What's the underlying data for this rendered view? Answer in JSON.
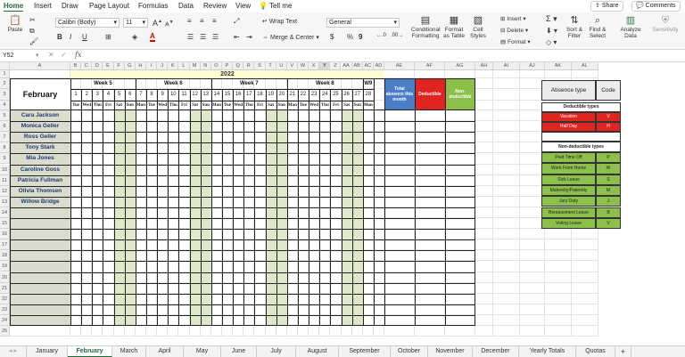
{
  "menu": {
    "tabs": [
      "Home",
      "Insert",
      "Draw",
      "Page Layout",
      "Formulas",
      "Data",
      "Review",
      "View"
    ],
    "tell_me": "Tell me",
    "share": "Share",
    "comments": "Comments"
  },
  "ribbon": {
    "paste": "Paste",
    "font_name": "Calibri (Body)",
    "font_size": "11",
    "bold": "B",
    "italic": "I",
    "underline": "U",
    "font_grow": "A",
    "font_shrink": "A",
    "wrap_text": "Wrap Text",
    "merge_center": "Merge & Center",
    "number_format": "General",
    "currency": "$",
    "percent": "%",
    "comma": "9",
    "conditional_formatting": [
      "Conditional",
      "Formatting"
    ],
    "format_as_table": [
      "Format",
      "as Table"
    ],
    "cell_styles": [
      "Cell",
      "Styles"
    ],
    "insert": "Insert",
    "delete": "Delete",
    "format": "Format",
    "sort_filter": [
      "Sort &",
      "Filter"
    ],
    "find_select": [
      "Find &",
      "Select"
    ],
    "analyze_data": [
      "Analyze",
      "Data"
    ],
    "sensitivity": "Sensitivity"
  },
  "formula_bar": {
    "name_box": "Y52",
    "fx": "fx",
    "value": ""
  },
  "columns": [
    "A",
    "B",
    "C",
    "D",
    "E",
    "F",
    "G",
    "H",
    "I",
    "J",
    "K",
    "L",
    "M",
    "N",
    "O",
    "P",
    "Q",
    "R",
    "S",
    "T",
    "U",
    "V",
    "W",
    "X",
    "Y",
    "Z",
    "AA",
    "AB",
    "AC",
    "AD",
    "AE",
    "AF",
    "AG",
    "AH",
    "AI",
    "AJ",
    "AK",
    "AL"
  ],
  "rows": [
    "1",
    "2",
    "3",
    "4",
    "5",
    "6",
    "7",
    "8",
    "9",
    "10",
    "11",
    "12",
    "13",
    "14",
    "15",
    "16",
    "17",
    "18",
    "19",
    "20",
    "21",
    "22",
    "23",
    "24",
    "25"
  ],
  "sheet": {
    "year": "2022",
    "month": "February",
    "weeks": [
      "Week 5",
      "Week 6",
      "Week 7",
      "Week 8",
      "W9"
    ],
    "dates": [
      "1",
      "2",
      "3",
      "4",
      "5",
      "6",
      "7",
      "8",
      "9",
      "10",
      "11",
      "12",
      "13",
      "14",
      "15",
      "16",
      "17",
      "18",
      "19",
      "20",
      "21",
      "22",
      "23",
      "24",
      "25",
      "26",
      "27",
      "28"
    ],
    "days": [
      "Tue",
      "Wed",
      "Thu",
      "Fri",
      "Sat",
      "Sun",
      "Mon",
      "Tue",
      "Wed",
      "Thu",
      "Fri",
      "Sat",
      "Sun",
      "Mon",
      "Tue",
      "Wed",
      "Thu",
      "Fri",
      "Sat",
      "Sun",
      "Mon",
      "Tue",
      "Wed",
      "Thu",
      "Fri",
      "Sat",
      "Sun",
      "Mon"
    ],
    "weekend_dates": [
      "5",
      "6",
      "12",
      "13",
      "19",
      "20",
      "26",
      "27"
    ],
    "employees": [
      "Cara Jackson",
      "Monica Geller",
      "Ross Geller",
      "Tony Stark",
      "Mia Jones",
      "Caroline Goss",
      "Patricia Fullman",
      "Olivia Thomsen",
      "Willow Bridge"
    ],
    "summary_headers": {
      "total": "Total absence this month",
      "deductible": "Deductible",
      "non_deductible": "Non-deductible"
    },
    "colors": {
      "header_yellow": "#fdfbd2",
      "weekend_green": "#dfe7c9",
      "name_fill": "#dcdcce",
      "name_text": "#1f3b6e",
      "total_blue": "#4a7ec6",
      "deductible_red": "#e0241f",
      "non_deductible_green": "#8cc04a"
    }
  },
  "legend": {
    "header_type": "Absence type",
    "header_code": "Code",
    "deductible_title": "Deductible types",
    "deductible": [
      {
        "type": "Vacation",
        "code": "V"
      },
      {
        "type": "Half Day",
        "code": "H"
      }
    ],
    "non_deductible_title": "Non-deductible types",
    "non_deductible": [
      {
        "type": "Paid Time Off",
        "code": "P"
      },
      {
        "type": "Work From Home",
        "code": "W"
      },
      {
        "type": "Sick Leave",
        "code": "S"
      },
      {
        "type": "Maternity/Paternity",
        "code": "M"
      },
      {
        "type": "Jury Duty",
        "code": "J"
      },
      {
        "type": "Bereavement Leave",
        "code": "B"
      },
      {
        "type": "Voting Leave",
        "code": "V"
      }
    ]
  },
  "sheet_tabs": [
    "January",
    "February",
    "March",
    "April",
    "May",
    "June",
    "July",
    "August",
    "September",
    "October",
    "November",
    "December",
    "Yearly Totals",
    "Quotas"
  ],
  "active_tab": "February",
  "add_sheet": "+"
}
